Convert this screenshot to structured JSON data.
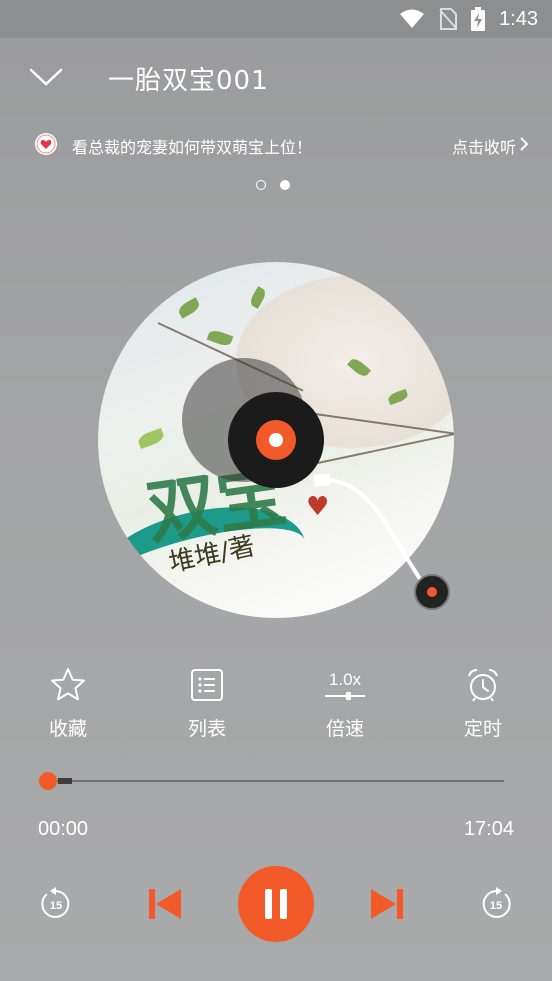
{
  "status_bar": {
    "time": "1:43"
  },
  "header": {
    "title": "一胎双宝001"
  },
  "promo": {
    "text": "看总裁的宠妻如何带双萌宝上位！",
    "link": "点击收听"
  },
  "carousel": {
    "pages": 2,
    "active_index": 1
  },
  "cover": {
    "art_title": "双宝",
    "art_author": "堆堆/著"
  },
  "actions": {
    "favorite": "收藏",
    "list": "列表",
    "speed": "倍速",
    "speed_value": "1.0x",
    "timer": "定时"
  },
  "progress": {
    "current": "00:00",
    "total": "17:04",
    "fraction": 0.0
  },
  "controls": {
    "rewind_seconds": "15",
    "forward_seconds": "15"
  },
  "colors": {
    "accent": "#f25a2a",
    "background": "#a3a4a5"
  }
}
